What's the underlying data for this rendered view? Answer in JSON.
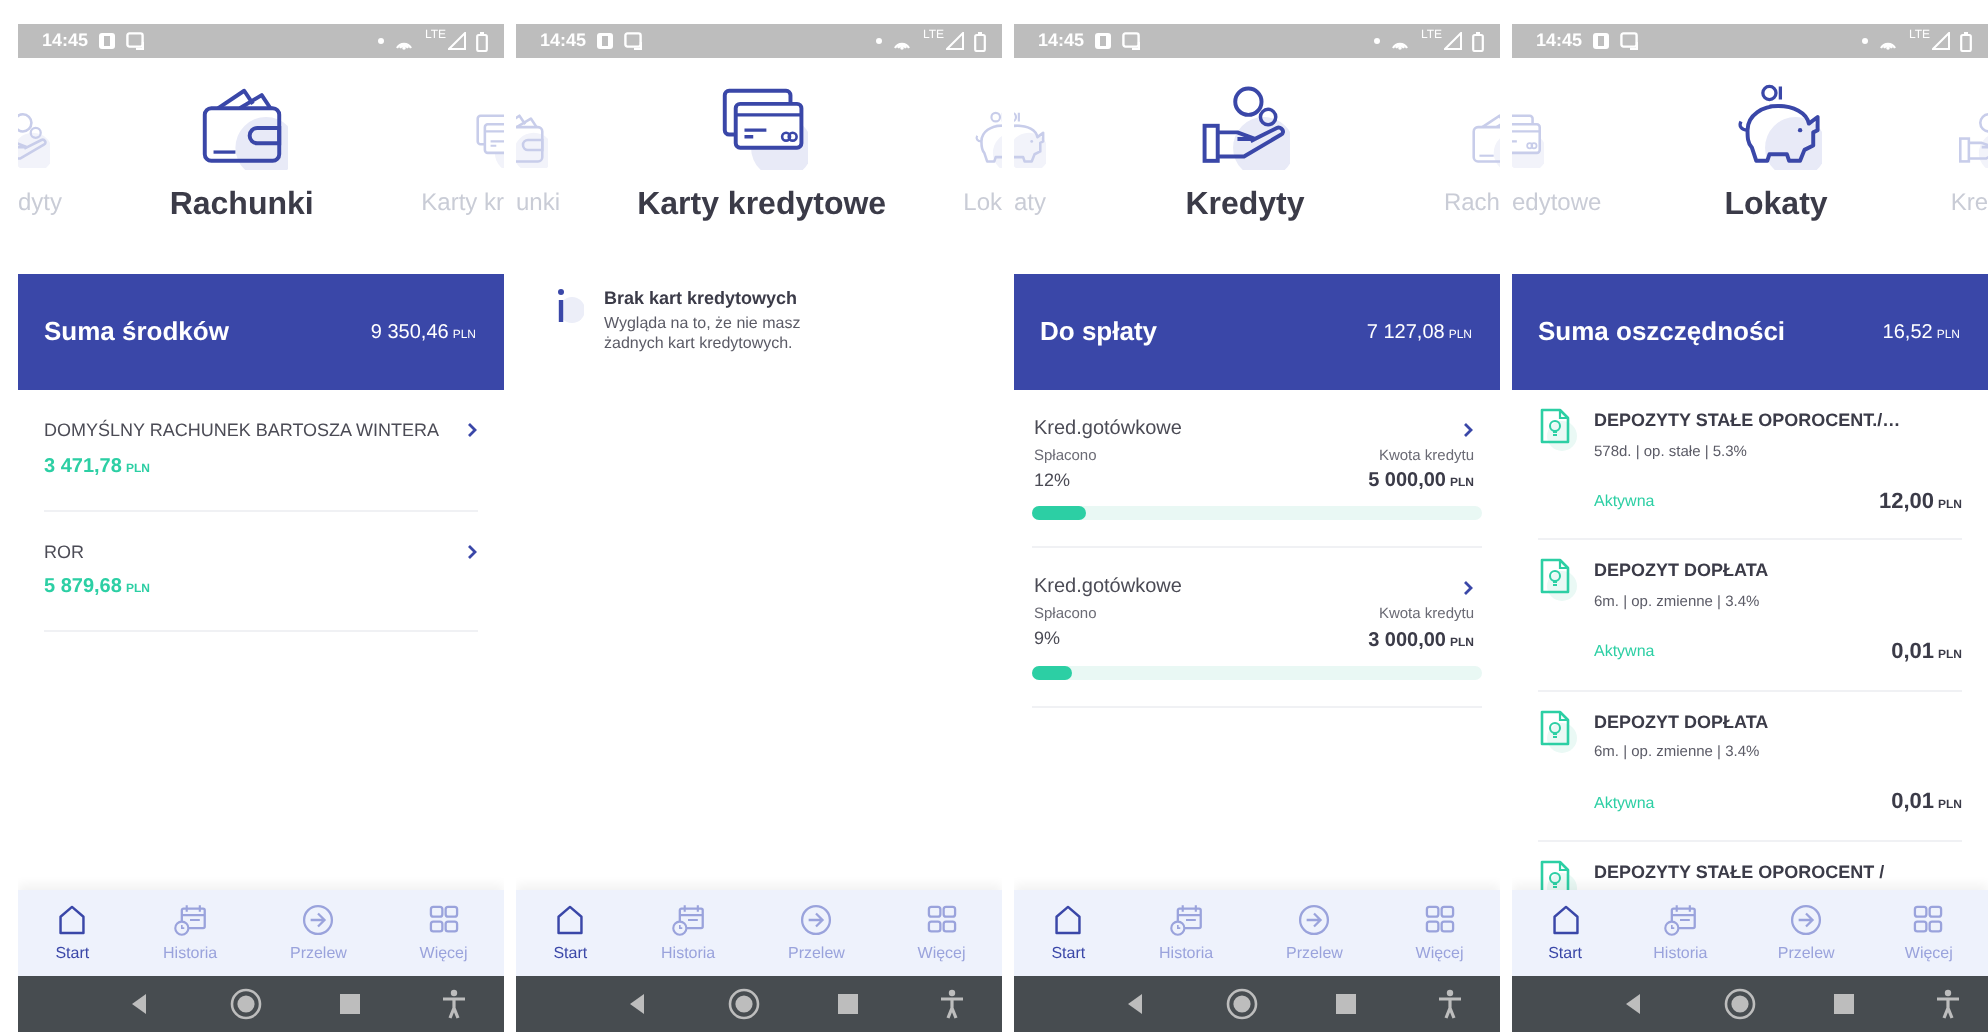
{
  "screens": [
    {
      "kind": "accounts",
      "status_bar": {
        "time": "14:45",
        "network": "LTE"
      },
      "carousel": {
        "previous": {
          "label": "dyty",
          "kind": "loans"
        },
        "current": {
          "label": "Rachunki",
          "kind": "accounts"
        },
        "next": {
          "label": "Karty kr",
          "kind": "cards"
        }
      },
      "summary": {
        "label": "Suma środków",
        "amount": "9 350,46",
        "currency": "PLN"
      },
      "accounts": [
        {
          "name": "DOMYŚLNY RACHUNEK BARTOSZA WINTERA",
          "amount": "3 471,78",
          "currency": "PLN"
        },
        {
          "name": "ROR",
          "amount": "5 879,68",
          "currency": "PLN"
        }
      ],
      "nav": [
        {
          "label": "Start",
          "kind": "home",
          "selected": true
        },
        {
          "label": "Historia",
          "kind": "history",
          "selected": false
        },
        {
          "label": "Przelew",
          "kind": "transfer",
          "selected": false
        },
        {
          "label": "Więcej",
          "kind": "more",
          "selected": false
        }
      ]
    },
    {
      "kind": "cards",
      "status_bar": {
        "time": "14:45",
        "network": "LTE"
      },
      "carousel": {
        "previous": {
          "label": "unki",
          "kind": "accounts"
        },
        "current": {
          "label": "Karty kredytowe",
          "kind": "cards"
        },
        "next": {
          "label": "Lok",
          "kind": "deposits"
        }
      },
      "empty_state": {
        "title": "Brak kart kredytowych",
        "text": "Wygląda na to, że nie masz żadnych kart kredytowych."
      },
      "nav": [
        {
          "label": "Start",
          "kind": "home",
          "selected": true
        },
        {
          "label": "Historia",
          "kind": "history",
          "selected": false
        },
        {
          "label": "Przelew",
          "kind": "transfer",
          "selected": false
        },
        {
          "label": "Więcej",
          "kind": "more",
          "selected": false
        }
      ]
    },
    {
      "kind": "loans",
      "status_bar": {
        "time": "14:45",
        "network": "LTE"
      },
      "carousel": {
        "previous": {
          "label": "aty",
          "kind": "deposits"
        },
        "current": {
          "label": "Kredyty",
          "kind": "loans"
        },
        "next": {
          "label": "Rach",
          "kind": "accounts"
        }
      },
      "summary": {
        "label": "Do spłaty",
        "amount": "7 127,08",
        "currency": "PLN"
      },
      "loans": [
        {
          "name": "Kred.gotówkowe",
          "paid_label": "Spłacono",
          "paid": "12%",
          "amount_label": "Kwota kredytu",
          "amount": "5 000,00",
          "currency": "PLN",
          "level": 0.12
        },
        {
          "name": "Kred.gotówkowe",
          "paid_label": "Spłacono",
          "paid": "9%",
          "amount_label": "Kwota kredytu",
          "amount": "3 000,00",
          "currency": "PLN",
          "level": 0.09
        }
      ],
      "nav": [
        {
          "label": "Start",
          "kind": "home",
          "selected": true
        },
        {
          "label": "Historia",
          "kind": "history",
          "selected": false
        },
        {
          "label": "Przelew",
          "kind": "transfer",
          "selected": false
        },
        {
          "label": "Więcej",
          "kind": "more",
          "selected": false
        }
      ]
    },
    {
      "kind": "deposits",
      "status_bar": {
        "time": "14:45",
        "network": "LTE"
      },
      "carousel": {
        "previous": {
          "label": "edytowe",
          "kind": "cards"
        },
        "current": {
          "label": "Lokaty",
          "kind": "deposits"
        },
        "next": {
          "label": "Kre",
          "kind": "loans"
        }
      },
      "summary": {
        "label": "Suma oszczędności",
        "amount": "16,52",
        "currency": "PLN"
      },
      "deposits": [
        {
          "name": "DEPOZYTY STAŁE OPOROCENT./…",
          "details": "578d. | op. stałe | 5.3%",
          "status": "Aktywna",
          "amount": "12,00",
          "currency": "PLN"
        },
        {
          "name": "DEPOZYT DOPŁATA",
          "details": "6m. | op. zmienne | 3.4%",
          "status": "Aktywna",
          "amount": "0,01",
          "currency": "PLN"
        },
        {
          "name": "DEPOZYT DOPŁATA",
          "details": "6m. | op. zmienne | 3.4%",
          "status": "Aktywna",
          "amount": "0,01",
          "currency": "PLN"
        },
        {
          "name": "DEPOZYTY STAŁE OPOROCENT /"
        }
      ],
      "nav": [
        {
          "label": "Start",
          "kind": "home",
          "selected": true
        },
        {
          "label": "Historia",
          "kind": "history",
          "selected": false
        },
        {
          "label": "Przelew",
          "kind": "transfer",
          "selected": false
        },
        {
          "label": "Więcej",
          "kind": "more",
          "selected": false
        }
      ]
    }
  ]
}
